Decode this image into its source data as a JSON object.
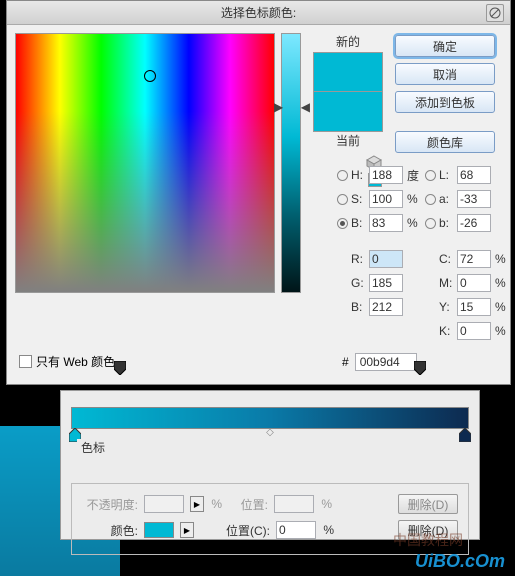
{
  "dialog": {
    "title": "选择色标颜色:",
    "swatch": {
      "new_label": "新的",
      "current_label": "当前"
    },
    "buttons": {
      "ok": "确定",
      "cancel": "取消",
      "add": "添加到色板",
      "library": "颜色库"
    },
    "hsb": {
      "H": {
        "label": "H:",
        "value": "188",
        "unit": "度"
      },
      "S": {
        "label": "S:",
        "value": "100",
        "unit": "%"
      },
      "B": {
        "label": "B:",
        "value": "83",
        "unit": "%"
      }
    },
    "lab": {
      "L": {
        "label": "L:",
        "value": "68"
      },
      "a": {
        "label": "a:",
        "value": "-33"
      },
      "b": {
        "label": "b:",
        "value": "-26"
      }
    },
    "rgb": {
      "R": {
        "label": "R:",
        "value": "0"
      },
      "G": {
        "label": "G:",
        "value": "185"
      },
      "B": {
        "label": "B:",
        "value": "212"
      }
    },
    "cmyk": {
      "C": {
        "label": "C:",
        "value": "72",
        "unit": "%"
      },
      "M": {
        "label": "M:",
        "value": "0",
        "unit": "%"
      },
      "Y": {
        "label": "Y:",
        "value": "15",
        "unit": "%"
      },
      "K": {
        "label": "K:",
        "value": "0",
        "unit": "%"
      }
    },
    "hex": {
      "prefix": "#",
      "value": "00b9d4"
    },
    "web_only": "只有 Web 颜色"
  },
  "gradient": {
    "section": "色标",
    "opacity_label": "不透明度:",
    "opacity_value": "",
    "color_label": "颜色:",
    "position_label_1": "位置:",
    "position_label_2": "位置(C):",
    "position_value": "0",
    "pct": "%",
    "delete": "删除(D)"
  },
  "watermark": {
    "main": "UiBO.cOm",
    "sub": "中国教程网"
  }
}
